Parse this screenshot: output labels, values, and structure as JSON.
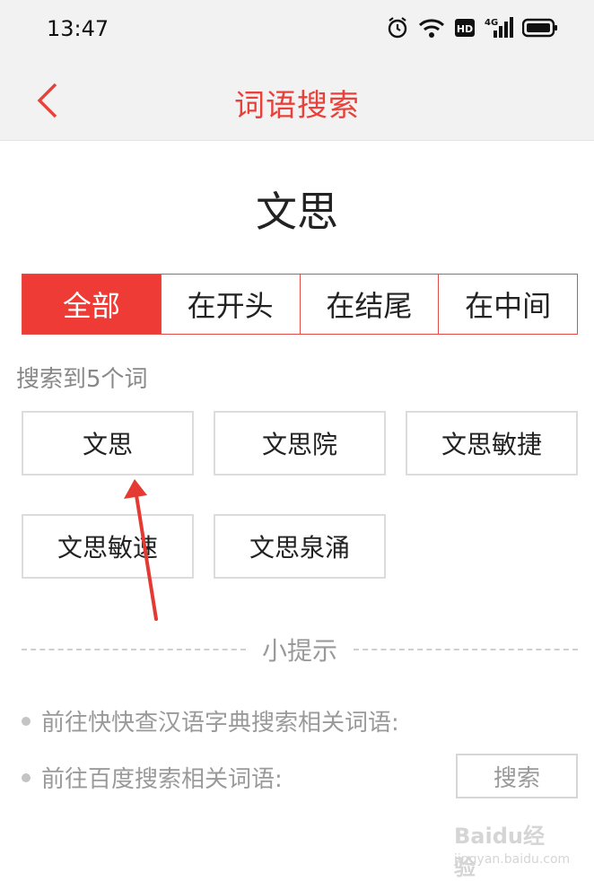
{
  "status_bar": {
    "time": "13:47",
    "icons": [
      "alarm-icon",
      "wifi-icon",
      "hd-icon",
      "signal-4g-icon",
      "battery-icon"
    ],
    "hd_label": "HD",
    "network_label": "4G"
  },
  "nav": {
    "title": "词语搜索",
    "back_icon": "chevron-left-icon"
  },
  "query_word": "文思",
  "tabs": [
    {
      "label": "全部",
      "active": true
    },
    {
      "label": "在开头",
      "active": false
    },
    {
      "label": "在结尾",
      "active": false
    },
    {
      "label": "在中间",
      "active": false
    }
  ],
  "result_count_text": "搜索到5个词",
  "results": [
    "文思",
    "文思院",
    "文思敏捷",
    "文思敏速",
    "文思泉涌"
  ],
  "tips": {
    "title": "小提示",
    "line1": "前往快快查汉语字典搜索相关词语:",
    "line2": "前往百度搜索相关词语:",
    "search_button": "搜索"
  },
  "watermark": {
    "main": "Baidu经验",
    "sub": "jingyan.baidu.com"
  },
  "colors": {
    "accent": "#e8413a",
    "active_tab_bg": "#ef3b35",
    "annotation_arrow": "#e53a33"
  }
}
